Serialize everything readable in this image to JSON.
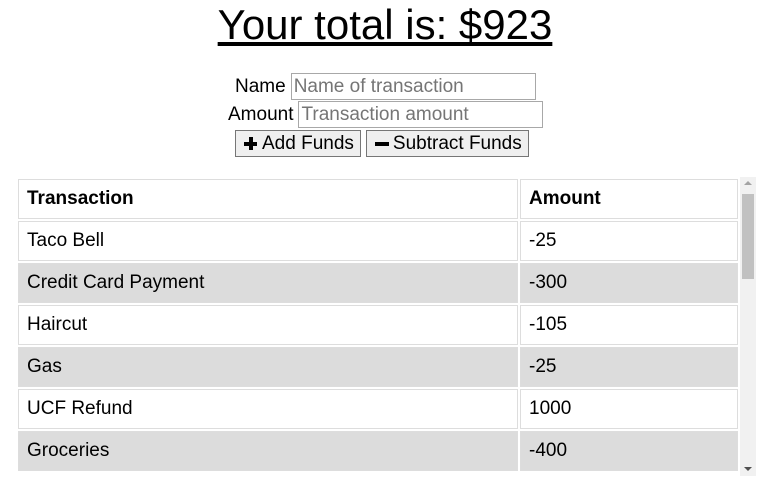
{
  "header": {
    "total_text": "Your total is: $923"
  },
  "form": {
    "name_label": "Name",
    "name_placeholder": "Name of transaction",
    "amount_label": "Amount",
    "amount_placeholder": "Transaction amount",
    "add_label": "Add Funds",
    "add_icon": "plus-icon",
    "subtract_label": "Subtract Funds",
    "subtract_icon": "minus-icon"
  },
  "table": {
    "headers": [
      "Transaction",
      "Amount"
    ],
    "rows": [
      {
        "name": "Taco Bell",
        "amount": "-25"
      },
      {
        "name": "Credit Card Payment",
        "amount": "-300"
      },
      {
        "name": "Haircut",
        "amount": "-105"
      },
      {
        "name": "Gas",
        "amount": "-25"
      },
      {
        "name": "UCF Refund",
        "amount": "1000"
      },
      {
        "name": "Groceries",
        "amount": "-400"
      }
    ],
    "alt_row_color": "#dcdcdc"
  }
}
